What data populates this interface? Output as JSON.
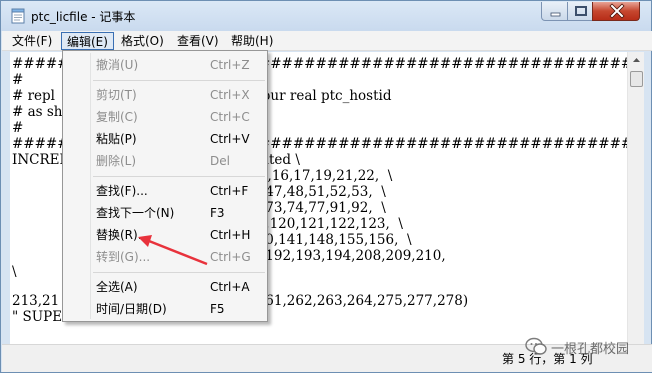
{
  "window": {
    "title": "ptc_licfile - 记事本"
  },
  "menubar": {
    "items": [
      {
        "label": "文件(F)"
      },
      {
        "label": "编辑(E)"
      },
      {
        "label": "格式(O)"
      },
      {
        "label": "查看(V)"
      },
      {
        "label": "帮助(H)"
      }
    ]
  },
  "editor": {
    "lines": [
      "########                  ##########################################",
      "#",
      "# repl                  very-feature with your real ptc_hostid",
      "# as sh",
      "#",
      "########                  ##########################################",
      "INCREME                 rmanent uncounted \\",
      "                           LO=(0,3,6,7,9,10,14,16,17,19,21,22,  \\",
      "                        34,35,36,37,40,41,45,47,48,51,52,53,  \\",
      "                        63,65,66,67,69,71,72,73,74,77,91,92,  \\",
      "                        ,115,116,117,118,119,120,121,122,123,  \\",
      "                        ,134,135,  137,139,140,141,148,155,156,  \\",
      "                        187,188,189,190,191,192,193,194,208,209,210,",
      "\\",
      "213,21                  251,253,259,260,261,262,263,264,275,277,278)",
      "\" SUPERSEDE \\"
    ]
  },
  "edit_menu": {
    "items": [
      {
        "label": "撤消(U)",
        "shortcut": "Ctrl+Z",
        "disabled": true
      },
      {
        "label": "剪切(T)",
        "shortcut": "Ctrl+X",
        "disabled": true
      },
      {
        "label": "复制(C)",
        "shortcut": "Ctrl+C",
        "disabled": true
      },
      {
        "label": "粘贴(P)",
        "shortcut": "Ctrl+V",
        "disabled": false
      },
      {
        "label": "删除(L)",
        "shortcut": "Del",
        "disabled": true
      },
      {
        "label": "查找(F)...",
        "shortcut": "Ctrl+F",
        "disabled": false
      },
      {
        "label": "查找下一个(N)",
        "shortcut": "F3",
        "disabled": false
      },
      {
        "label": "替换(R)...",
        "shortcut": "Ctrl+H",
        "disabled": false
      },
      {
        "label": "转到(G)...",
        "shortcut": "Ctrl+G",
        "disabled": true
      },
      {
        "label": "全选(A)",
        "shortcut": "Ctrl+A",
        "disabled": false
      },
      {
        "label": "时间/日期(D)",
        "shortcut": "F5",
        "disabled": false
      }
    ]
  },
  "statusbar": {
    "position": "第 5 行，第 1 列"
  },
  "watermark": {
    "text": "一根孔都校园"
  },
  "annotation": {
    "arrow_color": "#e8323c"
  }
}
